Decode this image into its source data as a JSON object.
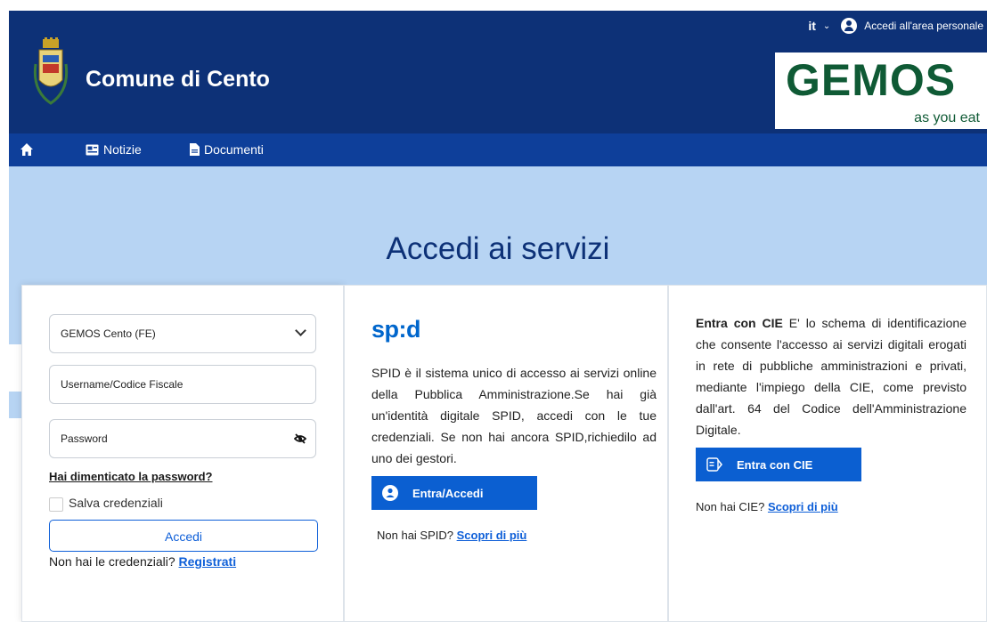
{
  "header": {
    "site_title": "Comune di Cento",
    "lang": "it",
    "user_link": "Accedi all'area personale",
    "logo_main": "GEMOS",
    "logo_sub": "as you eat"
  },
  "nav": {
    "home_icon": "home-icon",
    "items": [
      {
        "label": "Notizie",
        "icon": "newspaper-icon"
      },
      {
        "label": "Documenti",
        "icon": "document-icon"
      }
    ]
  },
  "hero": {
    "title": "Accedi ai servizi"
  },
  "login": {
    "select_value": "GEMOS Cento (FE)",
    "username_placeholder": "Username/Codice Fiscale",
    "password_placeholder": "Password",
    "forgot": "Hai dimenticato la password?",
    "save_label": "Salva credenziali",
    "submit": "Accedi",
    "no_cred_text": "Non hai le credenziali?",
    "register": "Registrati"
  },
  "spid": {
    "logo": "sp:d",
    "description": "SPID è il sistema unico di accesso ai servizi online della Pubblica Amministrazione.Se hai già un'identità digitale SPID, accedi con le tue credenziali. Se non hai ancora SPID,richiedilo ad uno dei gestori.",
    "button": "Entra/Accedi",
    "no_text": "Non hai SPID?",
    "more": "Scopri di più"
  },
  "cie": {
    "title": "Entra con CIE",
    "description": "E' lo schema di identificazione che consente l'accesso ai servizi digitali erogati in rete di pubbliche amministrazioni e privati, mediante l'impiego della CIE, come previsto dall'art. 64 del Codice dell'Amministrazione Digitale.",
    "button": "Entra con CIE",
    "no_text": "Non hai CIE?",
    "more": "Scopri di più"
  },
  "colors": {
    "header": "#0d3177",
    "nav": "#0e3f9a",
    "hero": "#b7d4f3",
    "primary": "#0b5fd1"
  }
}
